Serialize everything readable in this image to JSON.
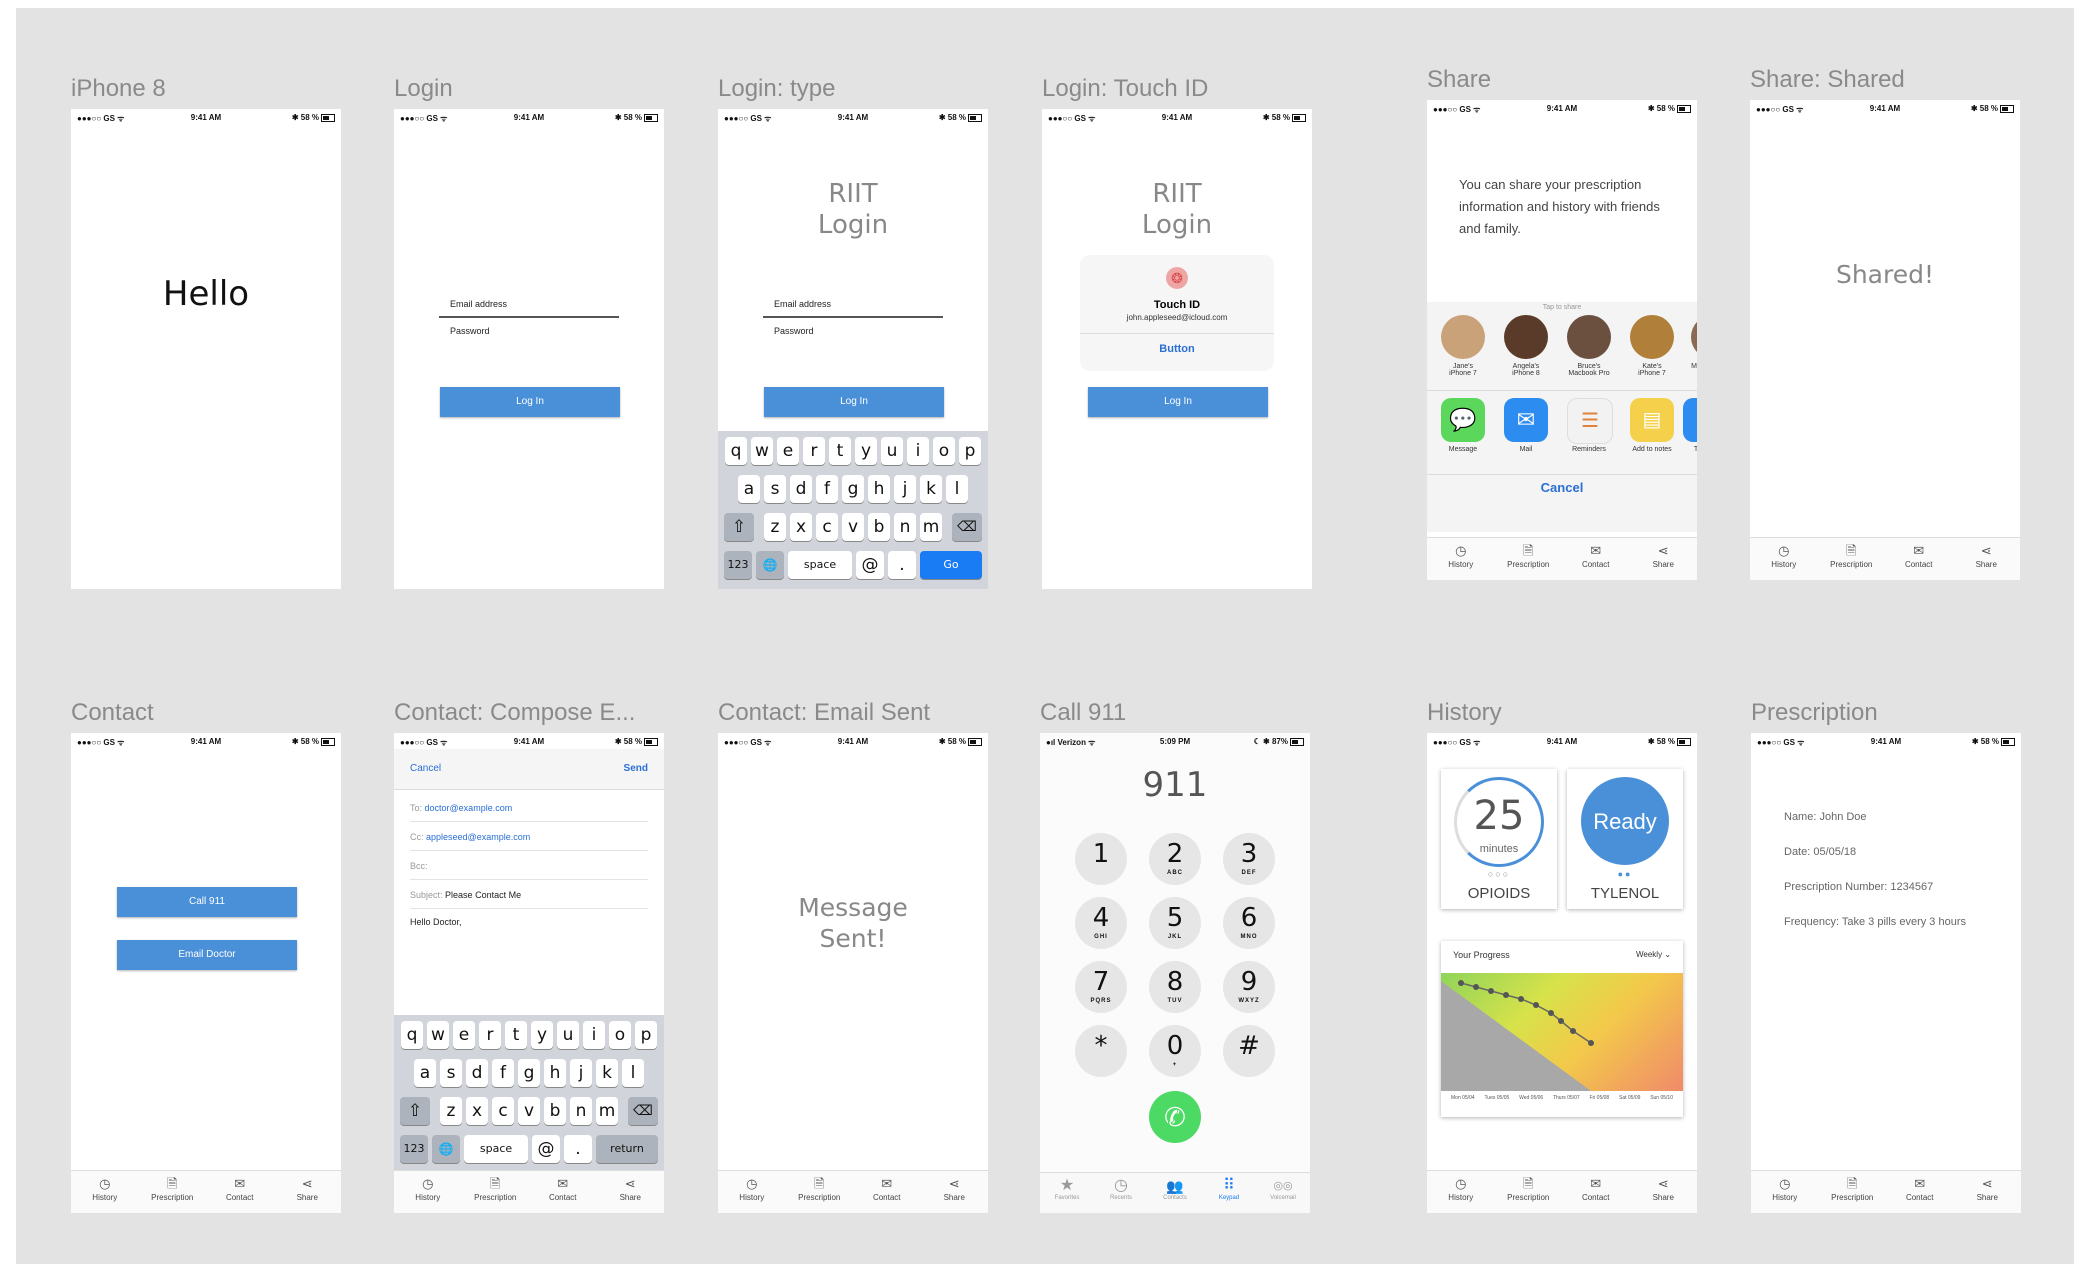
{
  "status": {
    "carrier": "●●●○○ GS ᯤ",
    "time": "9:41 AM",
    "battery": "✱ 58 %"
  },
  "status_call": {
    "carrier": "●ıl Verizon ᯤ",
    "time": "5:09 PM",
    "battery": "☾ ✱ 87%"
  },
  "tabs": [
    {
      "icon": "◷",
      "label": "History"
    },
    {
      "icon": "🗎",
      "label": "Prescription"
    },
    {
      "icon": "✉",
      "label": "Contact"
    },
    {
      "icon": "⋖",
      "label": "Share"
    }
  ],
  "kb": {
    "row1": [
      "q",
      "w",
      "e",
      "r",
      "t",
      "y",
      "u",
      "i",
      "o",
      "p"
    ],
    "row2": [
      "a",
      "s",
      "d",
      "f",
      "g",
      "h",
      "j",
      "k",
      "l"
    ],
    "row3": [
      "z",
      "x",
      "c",
      "v",
      "b",
      "n",
      "m"
    ],
    "shift": "⇧",
    "del": "⌫",
    "num": "123",
    "globe": "🌐",
    "space": "space",
    "at": "@",
    "dot": ".",
    "go": "Go",
    "return": "return"
  },
  "screens": {
    "iphone8": {
      "label": "iPhone 8",
      "hello": "Hello"
    },
    "login": {
      "label": "Login",
      "email": "Email address",
      "password": "Password",
      "button": "Log In"
    },
    "login_type": {
      "label": "Login: type",
      "title1": "RIIT",
      "title2": "Login",
      "email": "Email address",
      "password": "Password",
      "button": "Log In"
    },
    "login_touch": {
      "label": "Login: Touch ID",
      "title1": "RIIT",
      "title2": "Login",
      "touch_title": "Touch ID",
      "touch_email": "john.appleseed@icloud.com",
      "touch_button": "Button",
      "button": "Log In"
    },
    "share": {
      "label": "Share",
      "text": "You can share your prescription information and history with friends and family.",
      "tap": "Tap to share",
      "people": [
        {
          "name1": "Jane's",
          "name2": "iPhone 7",
          "color": "#c9a27a"
        },
        {
          "name1": "Angela's",
          "name2": "iPhone 8",
          "color": "#5a3b2a"
        },
        {
          "name1": "Bruce's",
          "name2": "Macbook Pro",
          "color": "#6b5040"
        },
        {
          "name1": "Kate's",
          "name2": "iPhone 7",
          "color": "#b0803a"
        },
        {
          "name1": "M",
          "name2": "",
          "color": "#8a6a55"
        }
      ],
      "apps": [
        {
          "name": "Message",
          "color": "#5bd75b",
          "icon": "💬"
        },
        {
          "name": "Mail",
          "color": "#2d8cf0",
          "icon": "✉"
        },
        {
          "name": "Reminders",
          "color": "#f2f2f2",
          "icon": "☰"
        },
        {
          "name": "Add to notes",
          "color": "#f5d04a",
          "icon": "▤"
        },
        {
          "name": "T",
          "color": "#2d8cf0",
          "icon": "V"
        }
      ],
      "cancel": "Cancel"
    },
    "share_shared": {
      "label": "Share: Shared",
      "text": "Shared!"
    },
    "contact": {
      "label": "Contact",
      "call": "Call 911",
      "email": "Email Doctor"
    },
    "compose": {
      "label": "Contact: Compose E...",
      "cancel": "Cancel",
      "send": "Send",
      "to_label": "To:",
      "to": "doctor@example.com",
      "cc_label": "Cc:",
      "cc": "appleseed@example.com",
      "bcc_label": "Bcc:",
      "subject_label": "Subject:",
      "subject": "Please Contact Me",
      "body": "Hello Doctor,"
    },
    "email_sent": {
      "label": "Contact: Email Sent",
      "text1": "Message",
      "text2": "Sent!"
    },
    "call911": {
      "label": "Call 911",
      "number": "911",
      "keys": [
        {
          "n": "1",
          "s": ""
        },
        {
          "n": "2",
          "s": "ABC"
        },
        {
          "n": "3",
          "s": "DEF"
        },
        {
          "n": "4",
          "s": "GHI"
        },
        {
          "n": "5",
          "s": "JKL"
        },
        {
          "n": "6",
          "s": "MNO"
        },
        {
          "n": "7",
          "s": "PQRS"
        },
        {
          "n": "8",
          "s": "TUV"
        },
        {
          "n": "9",
          "s": "WXYZ"
        },
        {
          "n": "*",
          "s": ""
        },
        {
          "n": "0",
          "s": "+"
        },
        {
          "n": "#",
          "s": ""
        }
      ],
      "call_icon": "✆",
      "bottom_tabs": [
        {
          "icon": "★",
          "label": "Favorites"
        },
        {
          "icon": "◷",
          "label": "Recents"
        },
        {
          "icon": "👥",
          "label": "Contacts"
        },
        {
          "icon": "⠿",
          "label": "Keypad"
        },
        {
          "icon": "◎◎",
          "label": "Voicemail"
        }
      ]
    },
    "history": {
      "label": "History",
      "card1_value": "25",
      "card1_unit": "minutes",
      "card1_name": "OPIOIDS",
      "card2_value": "Ready",
      "card2_name": "TYLENOL",
      "progress_title": "Your Progress",
      "progress_range": "Weekly ⌄",
      "days": [
        "Mon 05/04",
        "Tues 05/05",
        "Wed 05/06",
        "Thurs 05/07",
        "Fri 05/08",
        "Sat 05/09",
        "Sun 05/10"
      ]
    },
    "prescription": {
      "label": "Prescription",
      "name": "Name: John Doe",
      "date": "Date: 05/05/18",
      "number": "Prescription Number: 1234567",
      "frequency": "Frequency: Take 3 pills every 3 hours"
    }
  }
}
